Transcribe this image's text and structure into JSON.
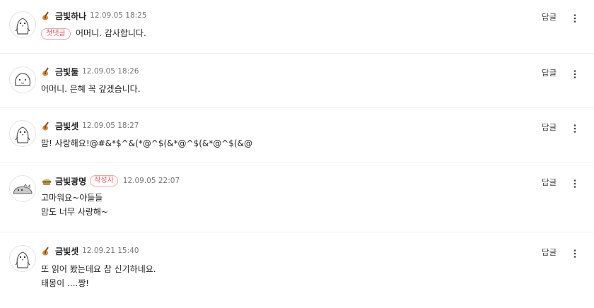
{
  "ui": {
    "reply_label": "답글",
    "first_comment_badge": "첫댓글",
    "author_badge": "작성자"
  },
  "comments": [
    {
      "nickname": "금빛하나",
      "date": "12.09.05 18:25",
      "text": "어머니. 감사합니다.",
      "first": true,
      "avatar": "penguin-avatar-icon",
      "level_icon": "guitar-level-icon"
    },
    {
      "nickname": "금빛둘",
      "date": "12.09.05 18:26",
      "text": "어머니. 은혜 꼭 갚겠습니다.",
      "avatar": "blob-avatar-icon",
      "level_icon": "guitar-level-icon"
    },
    {
      "nickname": "금빛셋",
      "date": "12.09.05 18:27",
      "text": "맘! 사랑해요!@#&*$^&(*@^$(&*@^$(&*@^$(&@",
      "avatar": "penguin-avatar-icon",
      "level_icon": "guitar-level-icon"
    },
    {
      "nickname": "금빛광명",
      "date": "12.09.05 22:07",
      "text": "고마워요~아들들\n맘도 너무 사랑해~",
      "author": true,
      "avatar": "seal-avatar-icon",
      "level_icon": "food-level-icon"
    },
    {
      "nickname": "금빛셋",
      "date": "12.09.21 15:40",
      "text": "또 읽어 봤는데요 참 신기하네요.\n태몽이 ....짱!",
      "avatar": "penguin-avatar-icon",
      "level_icon": "guitar-level-icon"
    }
  ],
  "colors": {
    "accent_badge": "#e4575f",
    "divider": "#f0f0f0",
    "date": "#777777"
  }
}
